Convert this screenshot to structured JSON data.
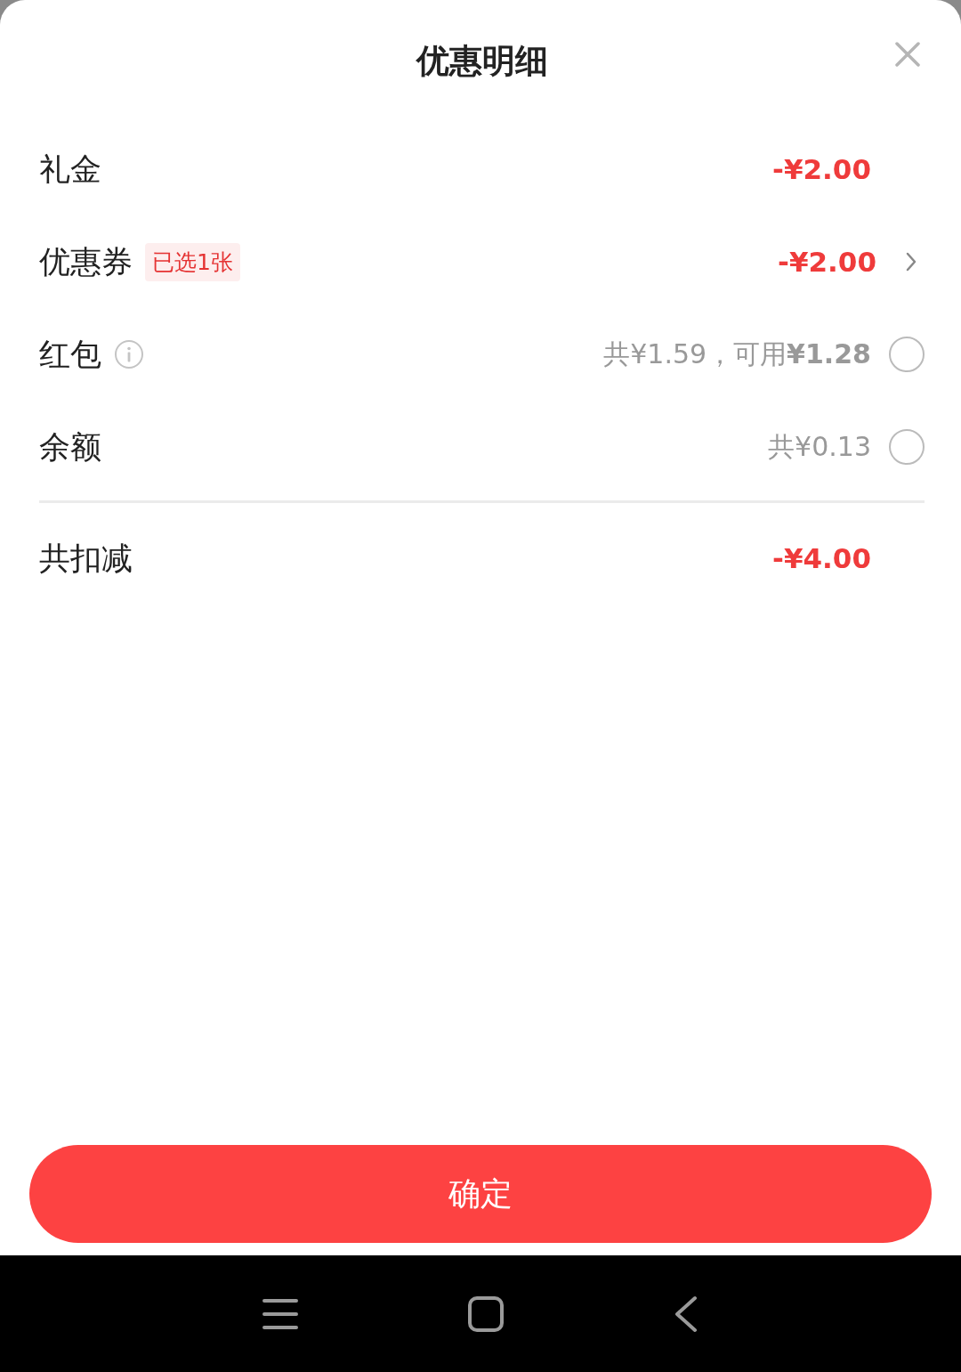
{
  "title": "优惠明细",
  "rows": [
    {
      "kind": "amount",
      "label": "礼金",
      "value": "-¥2.00"
    },
    {
      "kind": "link",
      "label": "优惠券",
      "tag": "已选1张",
      "value": "-¥2.00"
    },
    {
      "kind": "option",
      "label": "红包",
      "info": true,
      "value": "共¥1.59，可用**¥1.28**",
      "selected": false
    },
    {
      "kind": "option",
      "label": "余额",
      "info": false,
      "value": "共¥0.13",
      "selected": false
    }
  ],
  "summary": {
    "label": "共扣减",
    "value": "-¥4.00"
  },
  "confirm_button": "确定"
}
